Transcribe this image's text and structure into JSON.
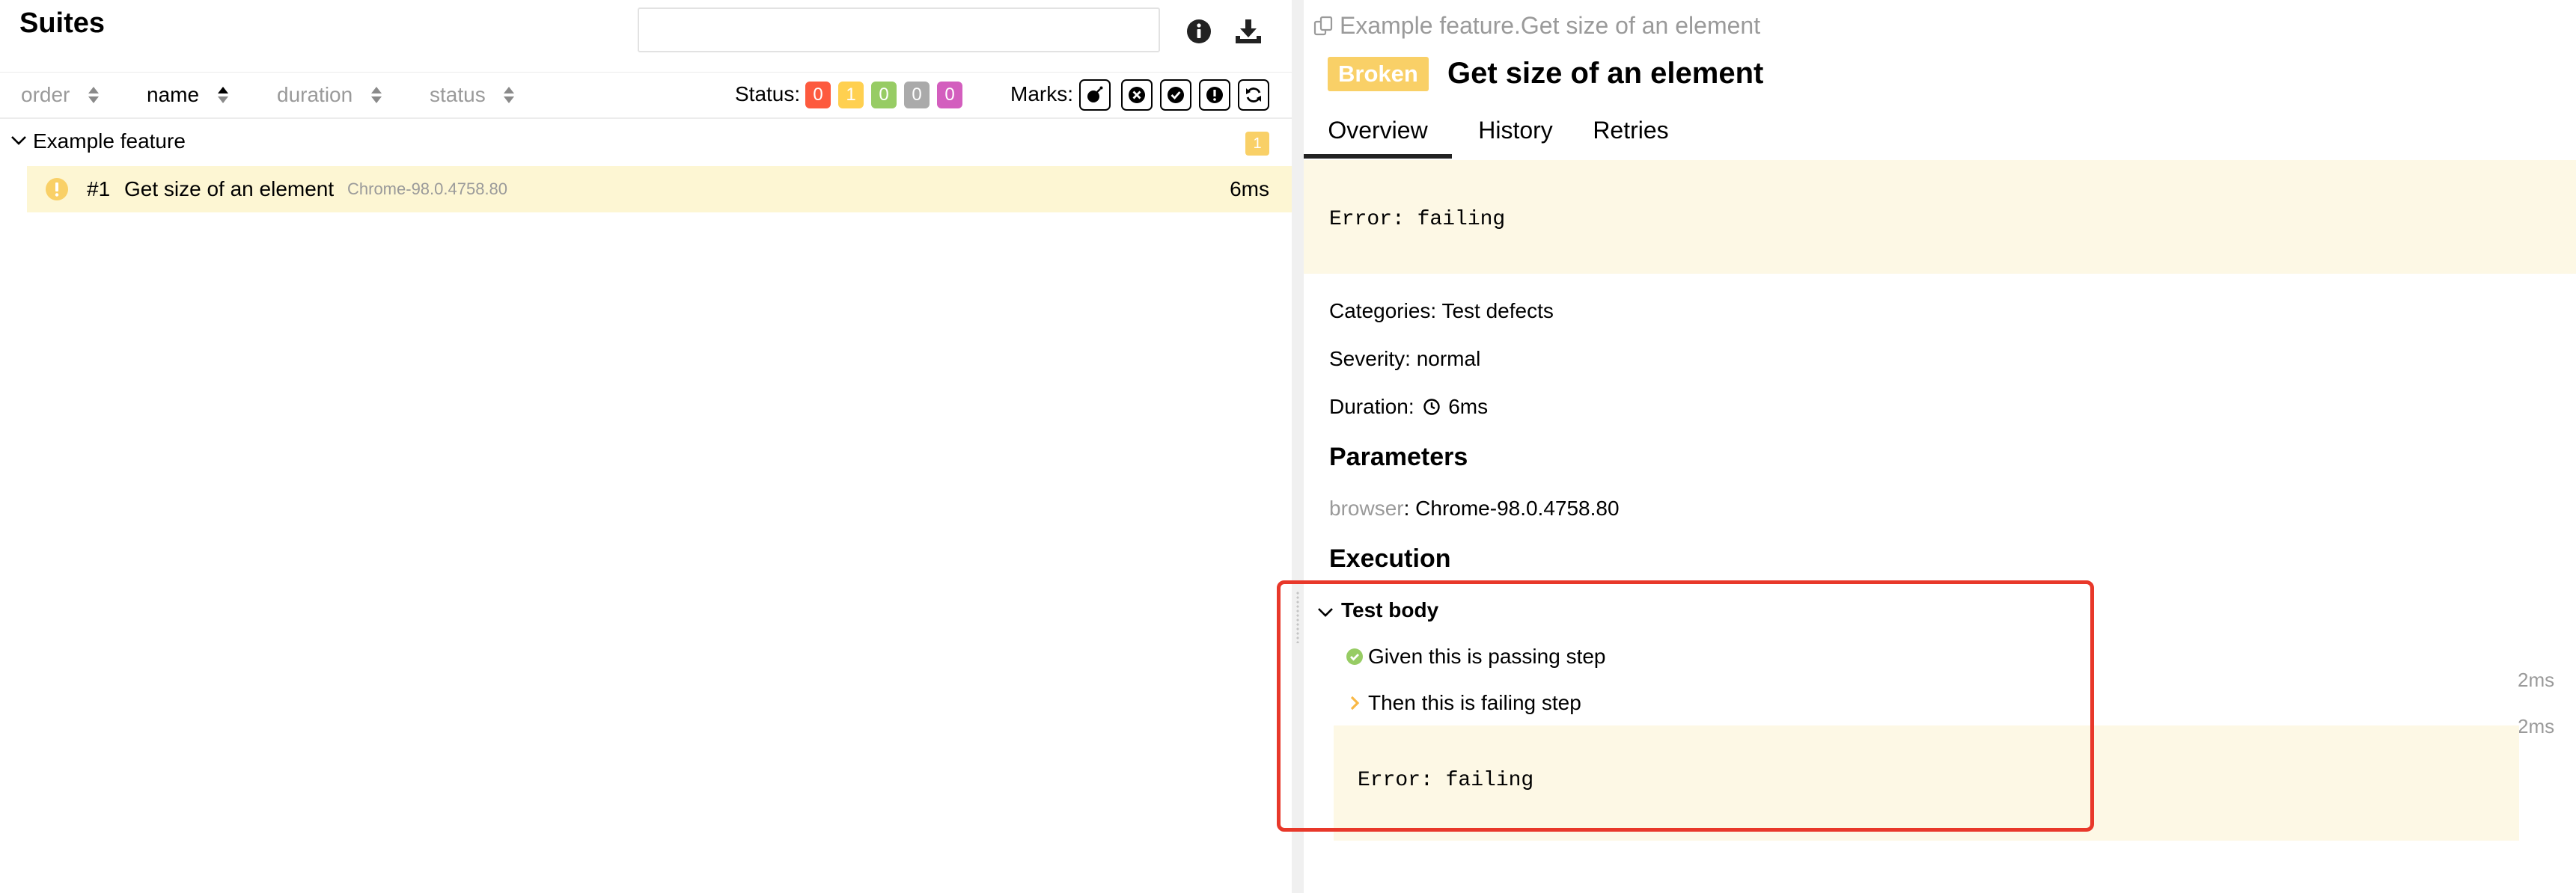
{
  "left": {
    "title": "Suites",
    "search": {
      "value": "",
      "placeholder": ""
    },
    "icons": {
      "info": "info-circle-icon",
      "download": "download-icon"
    },
    "sort_columns": [
      {
        "label": "order",
        "active": false
      },
      {
        "label": "name",
        "active": true
      },
      {
        "label": "duration",
        "active": false
      },
      {
        "label": "status",
        "active": false
      }
    ],
    "status_filter": {
      "label": "Status:",
      "counts": [
        {
          "status": "failed",
          "value": "0",
          "color": "#fd5a3e"
        },
        {
          "status": "broken",
          "value": "1",
          "color": "#ffd050"
        },
        {
          "status": "passed",
          "value": "0",
          "color": "#97cc64"
        },
        {
          "status": "skipped",
          "value": "0",
          "color": "#aaaaaa"
        },
        {
          "status": "unknown",
          "value": "0",
          "color": "#d35ebe"
        }
      ]
    },
    "marks": {
      "label": "Marks:",
      "items": [
        "bomb-icon",
        "times-circle-icon",
        "check-circle-icon",
        "exclamation-circle-icon",
        "refresh-icon"
      ]
    },
    "group": {
      "label": "Example feature",
      "count": "1"
    },
    "test": {
      "number": "#1",
      "name": "Get size of an element",
      "parameter": "Chrome-98.0.4758.80",
      "duration": "6ms",
      "status_color": "#ffd050"
    }
  },
  "right": {
    "breadcrumb": "Example feature.Get size of an element",
    "status_badge": "Broken",
    "title": "Get size of an element",
    "tabs": [
      "Overview",
      "History",
      "Retries"
    ],
    "error": "Error: failing",
    "categories": "Categories: Test defects",
    "severity": "Severity: normal",
    "duration_label": "Duration:",
    "duration_value": "6ms",
    "parameters_heading": "Parameters",
    "parameter_key": "browser",
    "parameter_value": ": Chrome-98.0.4758.80",
    "execution_heading": "Execution",
    "test_body": "Test body",
    "steps": [
      {
        "name": "Given this is passing step",
        "duration": "2ms",
        "status": "passed"
      },
      {
        "name": "Then this is failing step",
        "duration": "2ms",
        "status": "broken"
      }
    ],
    "step_error": "Error: failing"
  },
  "colors": {
    "highlight": "#e8382a",
    "broken": "#f9d067",
    "passed": "#97cc64"
  }
}
